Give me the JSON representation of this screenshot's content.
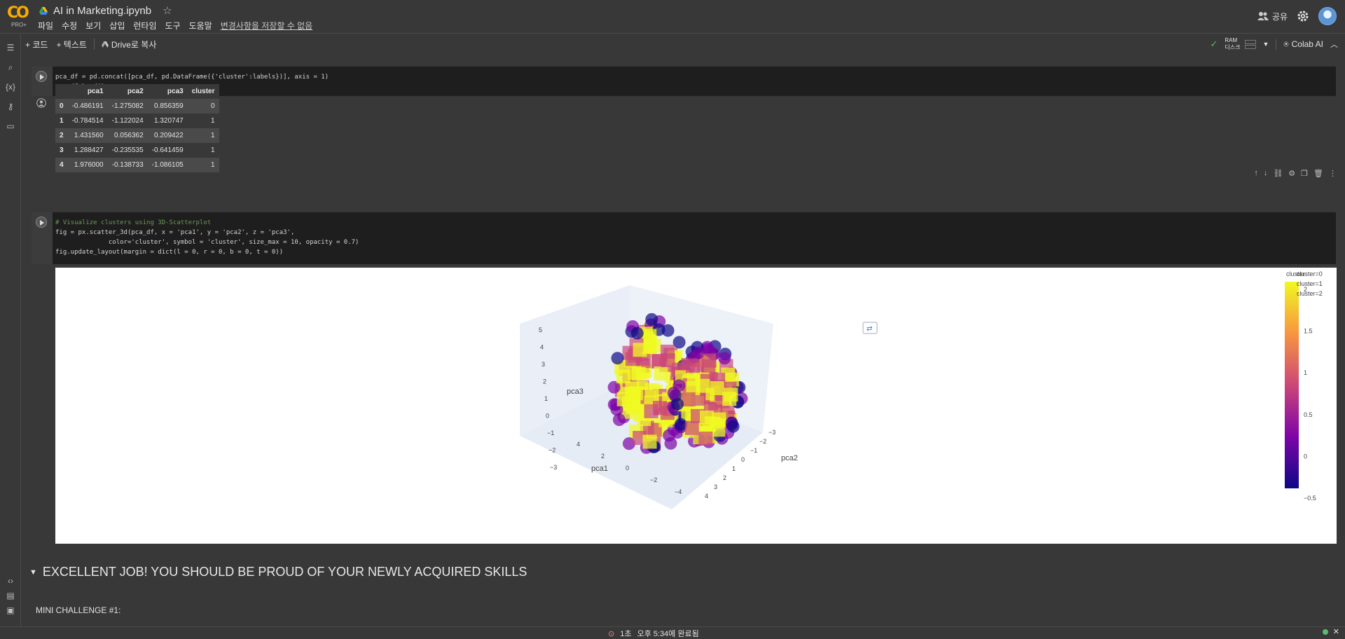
{
  "app": {
    "brand": "CO",
    "tier": "PRO+",
    "title": "AI in Marketing.ipynb"
  },
  "menu": [
    "파일",
    "수정",
    "보기",
    "삽입",
    "런타임",
    "도구",
    "도움말"
  ],
  "unsaved_note": "변경사항을 저장할 수 없음",
  "header": {
    "share_label": "공유"
  },
  "toolbar": {
    "add_code": "+ 코드",
    "add_text": "+ 텍스트",
    "copy_drive": "Drive로 복사",
    "ram_label": "RAM",
    "disk_label": "디스크",
    "colab_ai": "Colab AI"
  },
  "cell1": {
    "code_lines": [
      "pca_df = pd.concat([pca_df, pd.DataFrame({'cluster':labels})], axis = 1)",
      "pca_df.head()"
    ]
  },
  "table": {
    "columns": [
      "",
      "pca1",
      "pca2",
      "pca3",
      "cluster"
    ],
    "rows": [
      [
        "0",
        "-0.486191",
        "-1.275082",
        "0.856359",
        "0"
      ],
      [
        "1",
        "-0.784514",
        "-1.122024",
        "1.320747",
        "1"
      ],
      [
        "2",
        "1.431560",
        "0.056362",
        "0.209422",
        "1"
      ],
      [
        "3",
        "1.288427",
        "-0.235535",
        "-0.641459",
        "1"
      ],
      [
        "4",
        "1.976000",
        "-0.138733",
        "-1.086105",
        "1"
      ]
    ]
  },
  "cell2": {
    "code_lines": [
      "# Visualize clusters using 3D-Scatterplot",
      "fig = px.scatter_3d(pca_df, x = 'pca1', y = 'pca2', z = 'pca3',",
      "              color='cluster', symbol = 'cluster', size_max = 10, opacity = 0.7)",
      "fig.update_layout(margin = dict(l = 0, r = 0, b = 0, t = 0))"
    ]
  },
  "chart_data": {
    "type": "scatter",
    "xlabel": "pca1",
    "ylabel": "pca2",
    "zlabel": "pca3",
    "z_ticks": [
      "5",
      "4",
      "3",
      "2",
      "1",
      "0",
      "−1",
      "−2",
      "−3"
    ],
    "x_ticks": [
      "4",
      "2",
      "0",
      "−2",
      "−4"
    ],
    "y_ticks": [
      "−3",
      "−2",
      "−1",
      "0",
      "1",
      "2",
      "3",
      "4"
    ],
    "colorbar": {
      "title": "cluster",
      "ticks": [
        "2",
        "1.5",
        "1",
        "0.5",
        "0",
        "−0.5"
      ],
      "range": [
        -0.5,
        2
      ]
    },
    "legend": [
      "cluster=0",
      "cluster=1",
      "cluster=2"
    ],
    "colors": {
      "low": "#0d0887",
      "mid": "#cc4778",
      "high": "#f0f921"
    }
  },
  "markdown": {
    "heading": "EXCELLENT JOB! YOU SHOULD BE PROUD OF YOUR NEWLY ACQUIRED SKILLS",
    "challenge": "MINI CHALLENGE #1:"
  },
  "status": {
    "duration": "1초",
    "completed": "오후 5:34에 완료됨"
  }
}
